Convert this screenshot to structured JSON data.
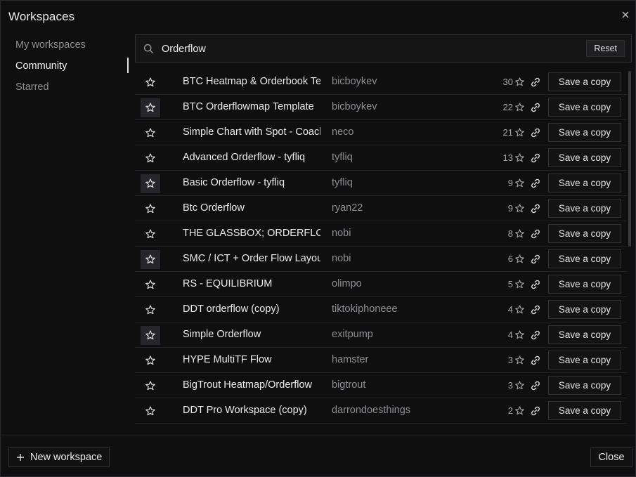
{
  "dialog": {
    "title": "Workspaces"
  },
  "sidebar": {
    "items": [
      {
        "label": "My workspaces"
      },
      {
        "label": "Community"
      },
      {
        "label": "Starred"
      }
    ]
  },
  "search": {
    "value": "Orderflow",
    "reset_label": "Reset"
  },
  "list": {
    "save_label": "Save a copy",
    "rows": [
      {
        "name": "BTC Heatmap & Orderbook Template",
        "author": "bicboykev",
        "stars": "30"
      },
      {
        "name": "BTC Orderflowmap Template",
        "author": "bicboykev",
        "stars": "22"
      },
      {
        "name": "Simple Chart with Spot - Coach",
        "author": "neco",
        "stars": "21"
      },
      {
        "name": "Advanced Orderflow - tyfliq",
        "author": "tyfliq",
        "stars": "13"
      },
      {
        "name": "Basic Orderflow - tyfliq",
        "author": "tyfliq",
        "stars": "9"
      },
      {
        "name": "Btc Orderflow",
        "author": "ryan22",
        "stars": "9"
      },
      {
        "name": "THE GLASSBOX; ORDERFLOW",
        "author": "nobi",
        "stars": "8"
      },
      {
        "name": "SMC / ICT + Order Flow Layout",
        "author": "nobi",
        "stars": "6"
      },
      {
        "name": "RS - EQUILIBRIUM",
        "author": "olimpo",
        "stars": "5"
      },
      {
        "name": "DDT orderflow (copy)",
        "author": "tiktokiphoneee",
        "stars": "4"
      },
      {
        "name": "Simple Orderflow",
        "author": "exitpump",
        "stars": "4"
      },
      {
        "name": "HYPE MultiTF Flow",
        "author": "hamster",
        "stars": "3"
      },
      {
        "name": "BigTrout Heatmap/Orderflow",
        "author": "bigtrout",
        "stars": "3"
      },
      {
        "name": "DDT Pro Workspace (copy)",
        "author": "darrondoesthings",
        "stars": "2"
      }
    ]
  },
  "footer": {
    "new_label": "New workspace",
    "close_label": "Close"
  },
  "icons": {
    "close": "close-icon",
    "search": "search-icon",
    "star": "star-outline-icon",
    "link": "link-icon",
    "plus": "plus-icon"
  }
}
